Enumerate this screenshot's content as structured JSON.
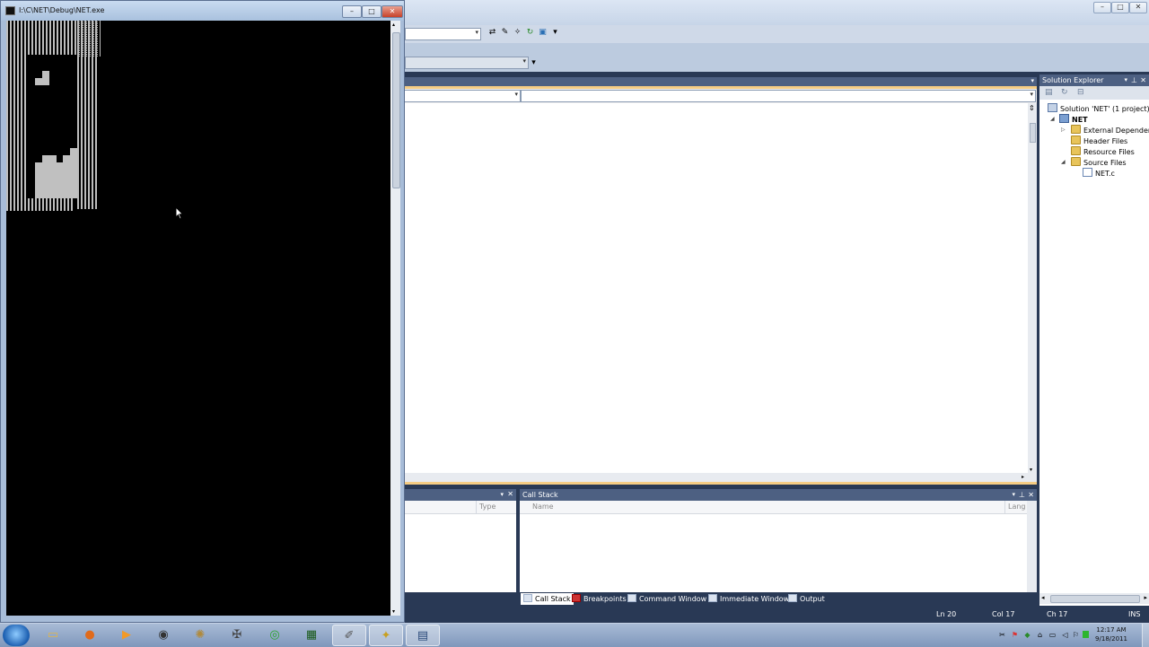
{
  "console": {
    "title": "I:\\C\\NET\\Debug\\NET.exe",
    "minimize": "–",
    "maximize": "□",
    "close": "✕"
  },
  "vs": {
    "window_controls": {
      "minimize": "–",
      "maximize": "□",
      "close": "✕"
    },
    "solution_explorer": {
      "title": "Solution Explorer",
      "items": [
        {
          "label": "Solution 'NET' (1 project)",
          "type": "solution"
        },
        {
          "label": "NET",
          "type": "project"
        },
        {
          "label": "External Dependenc",
          "type": "folder"
        },
        {
          "label": "Header Files",
          "type": "folder"
        },
        {
          "label": "Resource Files",
          "type": "folder"
        },
        {
          "label": "Source Files",
          "type": "folder"
        },
        {
          "label": "NET.c",
          "type": "file"
        }
      ]
    },
    "locals_panel": {
      "column_type": "Type"
    },
    "call_stack": {
      "title": "Call Stack",
      "col_name": "Name",
      "col_lang": "Lang"
    },
    "bottom_tabs": [
      {
        "label": "Call Stack",
        "active": true
      },
      {
        "label": "Breakpoints",
        "active": false
      },
      {
        "label": "Command Window",
        "active": false
      },
      {
        "label": "Immediate Window",
        "active": false
      },
      {
        "label": "Output",
        "active": false
      }
    ],
    "status": {
      "ln": "Ln 20",
      "col": "Col 17",
      "ch": "Ch 17",
      "mode": "INS"
    }
  },
  "taskbar": {
    "time": "12:17 AM",
    "date": "9/18/2011",
    "apps": [
      "explorer-icon",
      "firefox-icon",
      "media-player-icon",
      "sphere-icon",
      "tool-icon",
      "gear-app-icon",
      "green-app-icon",
      "terminal-icon",
      "paint-icon",
      "notes-icon",
      "window-icon"
    ]
  },
  "tetris": {
    "well_cols": 10,
    "well_rows": 21,
    "falling_piece": [
      [
        1,
        0
      ],
      [
        0,
        1
      ],
      [
        1,
        1
      ]
    ],
    "stack_heights": [
      0,
      0,
      0,
      0,
      5,
      6,
      6,
      5,
      6,
      7
    ]
  }
}
